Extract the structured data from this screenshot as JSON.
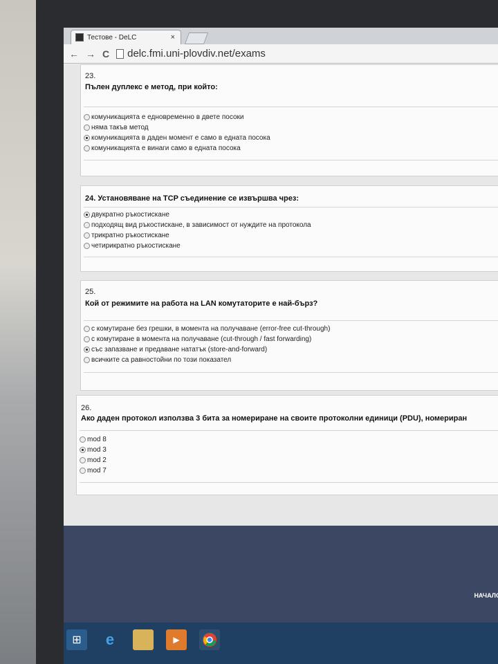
{
  "browser": {
    "tab_title": "Тестове - DeLC",
    "tab_close": "×",
    "nav_back": "←",
    "nav_forward": "→",
    "reload": "C",
    "url": "delc.fmi.uni-plovdiv.net/exams"
  },
  "questions": [
    {
      "number": "23.",
      "text": "Пълен дуплекс е метод, при който:",
      "options": [
        {
          "label": "комуникацията е едновременно в двете посоки",
          "selected": false
        },
        {
          "label": "няма такъв метод",
          "selected": false
        },
        {
          "label": "комуникацията в даден момент е само в едната посока",
          "selected": true
        },
        {
          "label": "комуникацията е винаги само в едната посока",
          "selected": false
        }
      ]
    },
    {
      "number": "24.",
      "text": "Установяване на TCP съединение се извършва чрез:",
      "options": [
        {
          "label": "двукратно ръкостискане",
          "selected": true
        },
        {
          "label": "подходящ вид ръкостискане, в зависимост от нуждите на протокола",
          "selected": false
        },
        {
          "label": "трикратно ръкостискане",
          "selected": false
        },
        {
          "label": "четирикратно ръкостискане",
          "selected": false
        }
      ]
    },
    {
      "number": "25.",
      "text": "Кой от режимите на работа на LAN комутаторите е най-бърз?",
      "options": [
        {
          "label": "с комутиране без грешки, в момента на получаване (error-free cut-through)",
          "selected": false
        },
        {
          "label": "с комутиране в момента на получаване (cut-through / fast forwarding)",
          "selected": false
        },
        {
          "label": "със запазване и предаване нататък (store-and-forward)",
          "selected": true
        },
        {
          "label": "всичките са равностойни по този показател",
          "selected": false
        }
      ]
    },
    {
      "number": "26.",
      "text": "Ако даден протокол използва 3 бита за номериране на своите протоколни единици (PDU), номериран",
      "options": [
        {
          "label": "mod 8",
          "selected": false
        },
        {
          "label": "mod 3",
          "selected": true
        },
        {
          "label": "mod 2",
          "selected": false
        },
        {
          "label": "mod 7",
          "selected": false
        }
      ]
    }
  ],
  "footer": {
    "home_label": "НАЧАЛО"
  },
  "colors": {
    "footer": "#3b4763",
    "taskbar": "#1f3f63"
  },
  "taskbar": {
    "icons": [
      "windows-start-icon",
      "internet-explorer-icon",
      "file-explorer-icon",
      "media-player-icon",
      "chrome-icon"
    ]
  }
}
